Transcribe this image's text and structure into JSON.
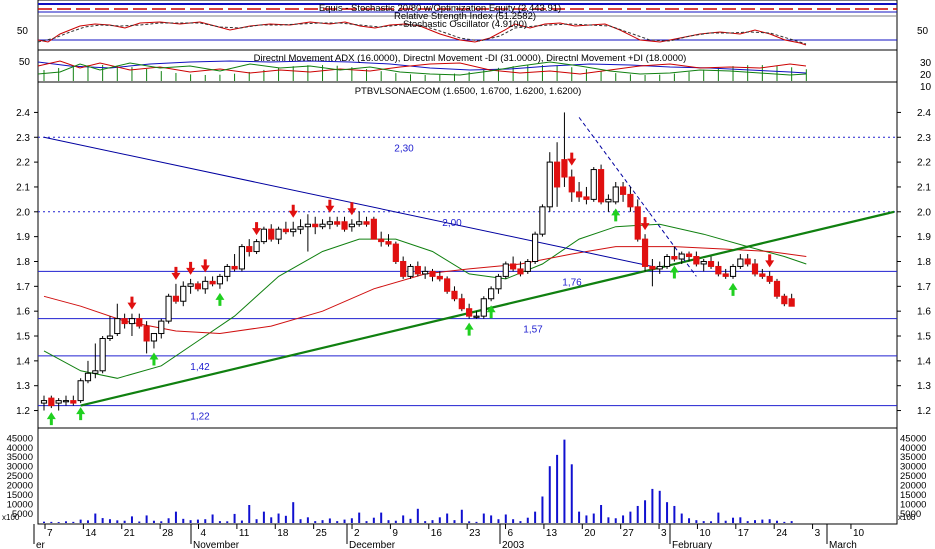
{
  "panels": {
    "equity_title": "Equis - Stochastic 20/80 w/Optimization Equity (2,443.91)",
    "rs_title": "Relative Strength Index (51.2582)",
    "stoch_title": "Stochastic Oscillator (4.9100)",
    "dmi_title": "Directnl Movement ADX (16.0000), Directnl Movement -DI (31.0000), Directnl Movement +DI (18.0000)",
    "price_title": "PTBVLSONAECOM (1.6500, 1.6700, 1.6200, 1.6200)",
    "volume_unit": "x100",
    "stoch_ticks": [
      "50"
    ],
    "dmi_left_ticks": [
      "50"
    ],
    "dmi_right_ticks": [
      "30",
      "20",
      "10"
    ]
  },
  "levels": [
    {
      "label": "2,30",
      "value": 2.3,
      "style": "dotted"
    },
    {
      "label": "2,00",
      "value": 2.0,
      "style": "dotted"
    },
    {
      "label": "1,76",
      "value": 1.76,
      "style": "solid"
    },
    {
      "label": "1,57",
      "value": 1.57,
      "style": "solid"
    },
    {
      "label": "1,42",
      "value": 1.42,
      "style": "solid"
    },
    {
      "label": "1,22",
      "value": 1.22,
      "style": "solid"
    }
  ],
  "x_axis": {
    "day_ticks": [
      "7",
      "14",
      "21",
      "28",
      "4",
      "11",
      "18",
      "25",
      "2",
      "9",
      "16",
      "23",
      "6",
      "13",
      "20",
      "27",
      "3",
      "10",
      "17",
      "24",
      "3",
      "10"
    ],
    "month_labels": [
      "er",
      "November",
      "December",
      "2003",
      "February",
      "March"
    ]
  },
  "colors": {
    "up_candle": "#ffffff",
    "down_candle": "#e01010",
    "buy_arrow": "#20d020",
    "sell_arrow": "#e01010",
    "trendline_up": "#108010",
    "trendline_down": "#0000a0",
    "ma_green": "#108010",
    "ma_red": "#d01010",
    "volume": "#1010d0",
    "levels": "#2020d0"
  },
  "chart_data": {
    "type": "candlestick",
    "title": "PTBVLSONAECOM (1.6500, 1.6700, 1.6200, 1.6200)",
    "y_ticks": [
      2.4,
      2.3,
      2.2,
      2.1,
      2.0,
      1.9,
      1.8,
      1.7,
      1.6,
      1.5,
      1.4,
      1.3,
      1.2
    ],
    "ylim": [
      1.17,
      2.45
    ],
    "volume_ticks": [
      45000,
      40000,
      35000,
      30000,
      25000,
      20000,
      15000,
      10000,
      5000
    ],
    "volume_unit": "x100",
    "volume_ylim": [
      0,
      47000
    ],
    "candles": [
      {
        "o": 1.23,
        "h": 1.26,
        "l": 1.2,
        "c": 1.24,
        "v": 700
      },
      {
        "o": 1.25,
        "h": 1.26,
        "l": 1.21,
        "c": 1.22,
        "v": 600
      },
      {
        "o": 1.23,
        "h": 1.25,
        "l": 1.2,
        "c": 1.24,
        "v": 500
      },
      {
        "o": 1.24,
        "h": 1.26,
        "l": 1.22,
        "c": 1.24,
        "v": 900
      },
      {
        "o": 1.24,
        "h": 1.26,
        "l": 1.22,
        "c": 1.23,
        "v": 600
      },
      {
        "o": 1.24,
        "h": 1.33,
        "l": 1.23,
        "c": 1.32,
        "v": 1800
      },
      {
        "o": 1.32,
        "h": 1.4,
        "l": 1.31,
        "c": 1.35,
        "v": 1400
      },
      {
        "o": 1.35,
        "h": 1.47,
        "l": 1.33,
        "c": 1.36,
        "v": 5000
      },
      {
        "o": 1.36,
        "h": 1.5,
        "l": 1.35,
        "c": 1.49,
        "v": 2600
      },
      {
        "o": 1.49,
        "h": 1.58,
        "l": 1.48,
        "c": 1.5,
        "v": 2000
      },
      {
        "o": 1.51,
        "h": 1.63,
        "l": 1.5,
        "c": 1.57,
        "v": 1400
      },
      {
        "o": 1.57,
        "h": 1.59,
        "l": 1.53,
        "c": 1.55,
        "v": 1200
      },
      {
        "o": 1.55,
        "h": 1.59,
        "l": 1.5,
        "c": 1.57,
        "v": 3500
      },
      {
        "o": 1.57,
        "h": 1.59,
        "l": 1.53,
        "c": 1.54,
        "v": 800
      },
      {
        "o": 1.54,
        "h": 1.56,
        "l": 1.43,
        "c": 1.48,
        "v": 4000
      },
      {
        "o": 1.48,
        "h": 1.51,
        "l": 1.45,
        "c": 1.51,
        "v": 1200
      },
      {
        "o": 1.51,
        "h": 1.57,
        "l": 1.49,
        "c": 1.56,
        "v": 900
      },
      {
        "o": 1.56,
        "h": 1.67,
        "l": 1.55,
        "c": 1.66,
        "v": 2500
      },
      {
        "o": 1.66,
        "h": 1.71,
        "l": 1.63,
        "c": 1.64,
        "v": 6000
      },
      {
        "o": 1.64,
        "h": 1.72,
        "l": 1.62,
        "c": 1.7,
        "v": 2200
      },
      {
        "o": 1.7,
        "h": 1.73,
        "l": 1.67,
        "c": 1.71,
        "v": 1500
      },
      {
        "o": 1.71,
        "h": 1.72,
        "l": 1.68,
        "c": 1.69,
        "v": 1800
      },
      {
        "o": 1.69,
        "h": 1.74,
        "l": 1.67,
        "c": 1.72,
        "v": 2000
      },
      {
        "o": 1.72,
        "h": 1.74,
        "l": 1.7,
        "c": 1.71,
        "v": 4500
      },
      {
        "o": 1.71,
        "h": 1.75,
        "l": 1.69,
        "c": 1.74,
        "v": 1000
      },
      {
        "o": 1.74,
        "h": 1.79,
        "l": 1.72,
        "c": 1.78,
        "v": 900
      },
      {
        "o": 1.78,
        "h": 1.83,
        "l": 1.76,
        "c": 1.77,
        "v": 4800
      },
      {
        "o": 1.77,
        "h": 1.87,
        "l": 1.76,
        "c": 1.86,
        "v": 1300
      },
      {
        "o": 1.86,
        "h": 1.89,
        "l": 1.82,
        "c": 1.84,
        "v": 9500
      },
      {
        "o": 1.84,
        "h": 1.89,
        "l": 1.83,
        "c": 1.88,
        "v": 2000
      },
      {
        "o": 1.88,
        "h": 1.94,
        "l": 1.87,
        "c": 1.93,
        "v": 6000
      },
      {
        "o": 1.93,
        "h": 1.95,
        "l": 1.88,
        "c": 1.89,
        "v": 3000
      },
      {
        "o": 1.89,
        "h": 1.94,
        "l": 1.87,
        "c": 1.93,
        "v": 5000
      },
      {
        "o": 1.93,
        "h": 1.96,
        "l": 1.91,
        "c": 1.92,
        "v": 3800
      },
      {
        "o": 1.92,
        "h": 1.96,
        "l": 1.9,
        "c": 1.93,
        "v": 11000
      },
      {
        "o": 1.93,
        "h": 1.97,
        "l": 1.91,
        "c": 1.94,
        "v": 2000
      },
      {
        "o": 1.94,
        "h": 1.99,
        "l": 1.84,
        "c": 1.95,
        "v": 3000
      },
      {
        "o": 1.95,
        "h": 1.98,
        "l": 1.91,
        "c": 1.94,
        "v": 1000
      },
      {
        "o": 1.94,
        "h": 1.97,
        "l": 1.93,
        "c": 1.95,
        "v": 1500
      },
      {
        "o": 1.95,
        "h": 1.98,
        "l": 1.93,
        "c": 1.96,
        "v": 2400
      },
      {
        "o": 1.96,
        "h": 1.98,
        "l": 1.94,
        "c": 1.95,
        "v": 1000
      },
      {
        "o": 1.96,
        "h": 1.98,
        "l": 1.92,
        "c": 1.93,
        "v": 1800
      },
      {
        "o": 1.94,
        "h": 1.97,
        "l": 1.92,
        "c": 1.95,
        "v": 2500
      },
      {
        "o": 1.95,
        "h": 2.0,
        "l": 1.94,
        "c": 1.96,
        "v": 5500
      },
      {
        "o": 1.96,
        "h": 1.98,
        "l": 1.94,
        "c": 1.95,
        "v": 1000
      },
      {
        "o": 1.97,
        "h": 1.98,
        "l": 1.89,
        "c": 1.89,
        "v": 2800
      },
      {
        "o": 1.89,
        "h": 1.92,
        "l": 1.86,
        "c": 1.88,
        "v": 5500
      },
      {
        "o": 1.88,
        "h": 1.91,
        "l": 1.86,
        "c": 1.87,
        "v": 1500
      },
      {
        "o": 1.87,
        "h": 1.88,
        "l": 1.79,
        "c": 1.8,
        "v": 1200
      },
      {
        "o": 1.8,
        "h": 1.82,
        "l": 1.73,
        "c": 1.74,
        "v": 4000
      },
      {
        "o": 1.74,
        "h": 1.79,
        "l": 1.73,
        "c": 1.78,
        "v": 2200
      },
      {
        "o": 1.78,
        "h": 1.8,
        "l": 1.74,
        "c": 1.75,
        "v": 7500
      },
      {
        "o": 1.75,
        "h": 1.78,
        "l": 1.73,
        "c": 1.76,
        "v": 1000
      },
      {
        "o": 1.76,
        "h": 1.77,
        "l": 1.72,
        "c": 1.74,
        "v": 1500
      },
      {
        "o": 1.74,
        "h": 1.76,
        "l": 1.72,
        "c": 1.73,
        "v": 3000
      },
      {
        "o": 1.73,
        "h": 1.74,
        "l": 1.67,
        "c": 1.68,
        "v": 5000
      },
      {
        "o": 1.68,
        "h": 1.7,
        "l": 1.64,
        "c": 1.65,
        "v": 1500
      },
      {
        "o": 1.65,
        "h": 1.67,
        "l": 1.6,
        "c": 1.61,
        "v": 7000
      },
      {
        "o": 1.61,
        "h": 1.63,
        "l": 1.57,
        "c": 1.58,
        "v": 900
      },
      {
        "o": 1.58,
        "h": 1.6,
        "l": 1.57,
        "c": 1.58,
        "v": 600
      },
      {
        "o": 1.58,
        "h": 1.66,
        "l": 1.57,
        "c": 1.65,
        "v": 5000
      },
      {
        "o": 1.65,
        "h": 1.7,
        "l": 1.64,
        "c": 1.69,
        "v": 4000
      },
      {
        "o": 1.69,
        "h": 1.75,
        "l": 1.67,
        "c": 1.74,
        "v": 2000
      },
      {
        "o": 1.74,
        "h": 1.8,
        "l": 1.73,
        "c": 1.79,
        "v": 4500
      },
      {
        "o": 1.79,
        "h": 1.82,
        "l": 1.76,
        "c": 1.77,
        "v": 2000
      },
      {
        "o": 1.77,
        "h": 1.8,
        "l": 1.74,
        "c": 1.75,
        "v": 1000
      },
      {
        "o": 1.76,
        "h": 1.81,
        "l": 1.75,
        "c": 1.8,
        "v": 2800
      },
      {
        "o": 1.8,
        "h": 1.92,
        "l": 1.79,
        "c": 1.91,
        "v": 6000
      },
      {
        "o": 1.91,
        "h": 2.03,
        "l": 1.9,
        "c": 2.02,
        "v": 14000
      },
      {
        "o": 2.02,
        "h": 2.24,
        "l": 2.0,
        "c": 2.2,
        "v": 30000
      },
      {
        "o": 2.2,
        "h": 2.28,
        "l": 2.02,
        "c": 2.1,
        "v": 36000
      },
      {
        "o": 2.21,
        "h": 2.4,
        "l": 2.1,
        "c": 2.14,
        "v": 44000
      },
      {
        "o": 2.14,
        "h": 2.17,
        "l": 2.04,
        "c": 2.08,
        "v": 31000
      },
      {
        "o": 2.08,
        "h": 2.12,
        "l": 2.04,
        "c": 2.06,
        "v": 6000
      },
      {
        "o": 2.06,
        "h": 2.1,
        "l": 2.03,
        "c": 2.05,
        "v": 4000
      },
      {
        "o": 2.05,
        "h": 2.18,
        "l": 2.04,
        "c": 2.17,
        "v": 5000
      },
      {
        "o": 2.17,
        "h": 2.19,
        "l": 2.03,
        "c": 2.04,
        "v": 9500
      },
      {
        "o": 2.04,
        "h": 2.07,
        "l": 2.0,
        "c": 2.05,
        "v": 3000
      },
      {
        "o": 2.04,
        "h": 2.12,
        "l": 2.03,
        "c": 2.1,
        "v": 2500
      },
      {
        "o": 2.1,
        "h": 2.12,
        "l": 2.04,
        "c": 2.07,
        "v": 4000
      },
      {
        "o": 2.07,
        "h": 2.1,
        "l": 2.0,
        "c": 2.02,
        "v": 6000
      },
      {
        "o": 2.02,
        "h": 2.05,
        "l": 1.88,
        "c": 1.89,
        "v": 9000
      },
      {
        "o": 1.89,
        "h": 1.91,
        "l": 1.76,
        "c": 1.78,
        "v": 12000
      },
      {
        "o": 1.78,
        "h": 1.81,
        "l": 1.7,
        "c": 1.77,
        "v": 18000
      },
      {
        "o": 1.77,
        "h": 1.8,
        "l": 1.75,
        "c": 1.78,
        "v": 17000
      },
      {
        "o": 1.78,
        "h": 1.83,
        "l": 1.77,
        "c": 1.82,
        "v": 11000
      },
      {
        "o": 1.82,
        "h": 1.86,
        "l": 1.8,
        "c": 1.81,
        "v": 9000
      },
      {
        "o": 1.81,
        "h": 1.84,
        "l": 1.79,
        "c": 1.83,
        "v": 5000
      },
      {
        "o": 1.83,
        "h": 1.84,
        "l": 1.8,
        "c": 1.82,
        "v": 2500
      },
      {
        "o": 1.82,
        "h": 1.84,
        "l": 1.78,
        "c": 1.79,
        "v": 1500
      },
      {
        "o": 1.79,
        "h": 1.81,
        "l": 1.76,
        "c": 1.8,
        "v": 1000
      },
      {
        "o": 1.8,
        "h": 1.82,
        "l": 1.77,
        "c": 1.78,
        "v": 900
      },
      {
        "o": 1.78,
        "h": 1.8,
        "l": 1.74,
        "c": 1.75,
        "v": 5500
      },
      {
        "o": 1.75,
        "h": 1.77,
        "l": 1.73,
        "c": 1.74,
        "v": 1200
      },
      {
        "o": 1.74,
        "h": 1.79,
        "l": 1.73,
        "c": 1.78,
        "v": 2800
      },
      {
        "o": 1.78,
        "h": 1.83,
        "l": 1.77,
        "c": 1.81,
        "v": 3000
      },
      {
        "o": 1.81,
        "h": 1.83,
        "l": 1.78,
        "c": 1.79,
        "v": 1000
      },
      {
        "o": 1.79,
        "h": 1.81,
        "l": 1.74,
        "c": 1.75,
        "v": 1500
      },
      {
        "o": 1.75,
        "h": 1.77,
        "l": 1.73,
        "c": 1.74,
        "v": 1800
      },
      {
        "o": 1.74,
        "h": 1.76,
        "l": 1.71,
        "c": 1.72,
        "v": 2000
      },
      {
        "o": 1.72,
        "h": 1.73,
        "l": 1.65,
        "c": 1.66,
        "v": 1200
      },
      {
        "o": 1.66,
        "h": 1.67,
        "l": 1.62,
        "c": 1.63,
        "v": 600
      },
      {
        "o": 1.65,
        "h": 1.67,
        "l": 1.62,
        "c": 1.62,
        "v": 1000
      }
    ],
    "signals": [
      {
        "i": 1,
        "type": "buy"
      },
      {
        "i": 5,
        "type": "buy"
      },
      {
        "i": 12,
        "type": "sell"
      },
      {
        "i": 15,
        "type": "buy"
      },
      {
        "i": 18,
        "type": "sell"
      },
      {
        "i": 20,
        "type": "sell"
      },
      {
        "i": 22,
        "type": "sell"
      },
      {
        "i": 24,
        "type": "buy"
      },
      {
        "i": 29,
        "type": "sell"
      },
      {
        "i": 34,
        "type": "sell"
      },
      {
        "i": 39,
        "type": "sell"
      },
      {
        "i": 42,
        "type": "sell"
      },
      {
        "i": 58,
        "type": "buy"
      },
      {
        "i": 61,
        "type": "buy"
      },
      {
        "i": 72,
        "type": "sell"
      },
      {
        "i": 78,
        "type": "buy"
      },
      {
        "i": 82,
        "type": "sell"
      },
      {
        "i": 86,
        "type": "buy"
      },
      {
        "i": 94,
        "type": "buy"
      },
      {
        "i": 99,
        "type": "sell"
      }
    ],
    "trendlines": [
      {
        "color": "green",
        "from": {
          "i": 5,
          "y": 1.22
        },
        "to": {
          "i": 116,
          "y": 2.0
        }
      },
      {
        "color": "blue",
        "from": {
          "i": 0,
          "y": 2.3
        },
        "to": {
          "i": 83,
          "y": 1.78
        }
      },
      {
        "color": "blue",
        "dashed": true,
        "from": {
          "i": 73,
          "y": 2.38
        },
        "to": {
          "i": 89,
          "y": 1.74
        }
      }
    ],
    "moving_averages": [
      {
        "color": "green",
        "points": [
          [
            0,
            1.44
          ],
          [
            5,
            1.36
          ],
          [
            10,
            1.33
          ],
          [
            16,
            1.38
          ],
          [
            21,
            1.48
          ],
          [
            26,
            1.58
          ],
          [
            32,
            1.74
          ],
          [
            38,
            1.84
          ],
          [
            43,
            1.89
          ],
          [
            48,
            1.89
          ],
          [
            53,
            1.84
          ],
          [
            58,
            1.75
          ],
          [
            63,
            1.73
          ],
          [
            68,
            1.79
          ],
          [
            73,
            1.89
          ],
          [
            78,
            1.94
          ],
          [
            84,
            1.95
          ],
          [
            90,
            1.91
          ],
          [
            96,
            1.86
          ],
          [
            101,
            1.82
          ],
          [
            104,
            1.79
          ]
        ]
      },
      {
        "color": "red",
        "points": [
          [
            0,
            1.66
          ],
          [
            5,
            1.62
          ],
          [
            11,
            1.56
          ],
          [
            18,
            1.52
          ],
          [
            24,
            1.51
          ],
          [
            31,
            1.54
          ],
          [
            38,
            1.6
          ],
          [
            45,
            1.69
          ],
          [
            52,
            1.75
          ],
          [
            58,
            1.77
          ],
          [
            65,
            1.79
          ],
          [
            72,
            1.83
          ],
          [
            78,
            1.86
          ],
          [
            86,
            1.86
          ],
          [
            93,
            1.85
          ],
          [
            99,
            1.84
          ],
          [
            104,
            1.82
          ]
        ]
      }
    ]
  }
}
